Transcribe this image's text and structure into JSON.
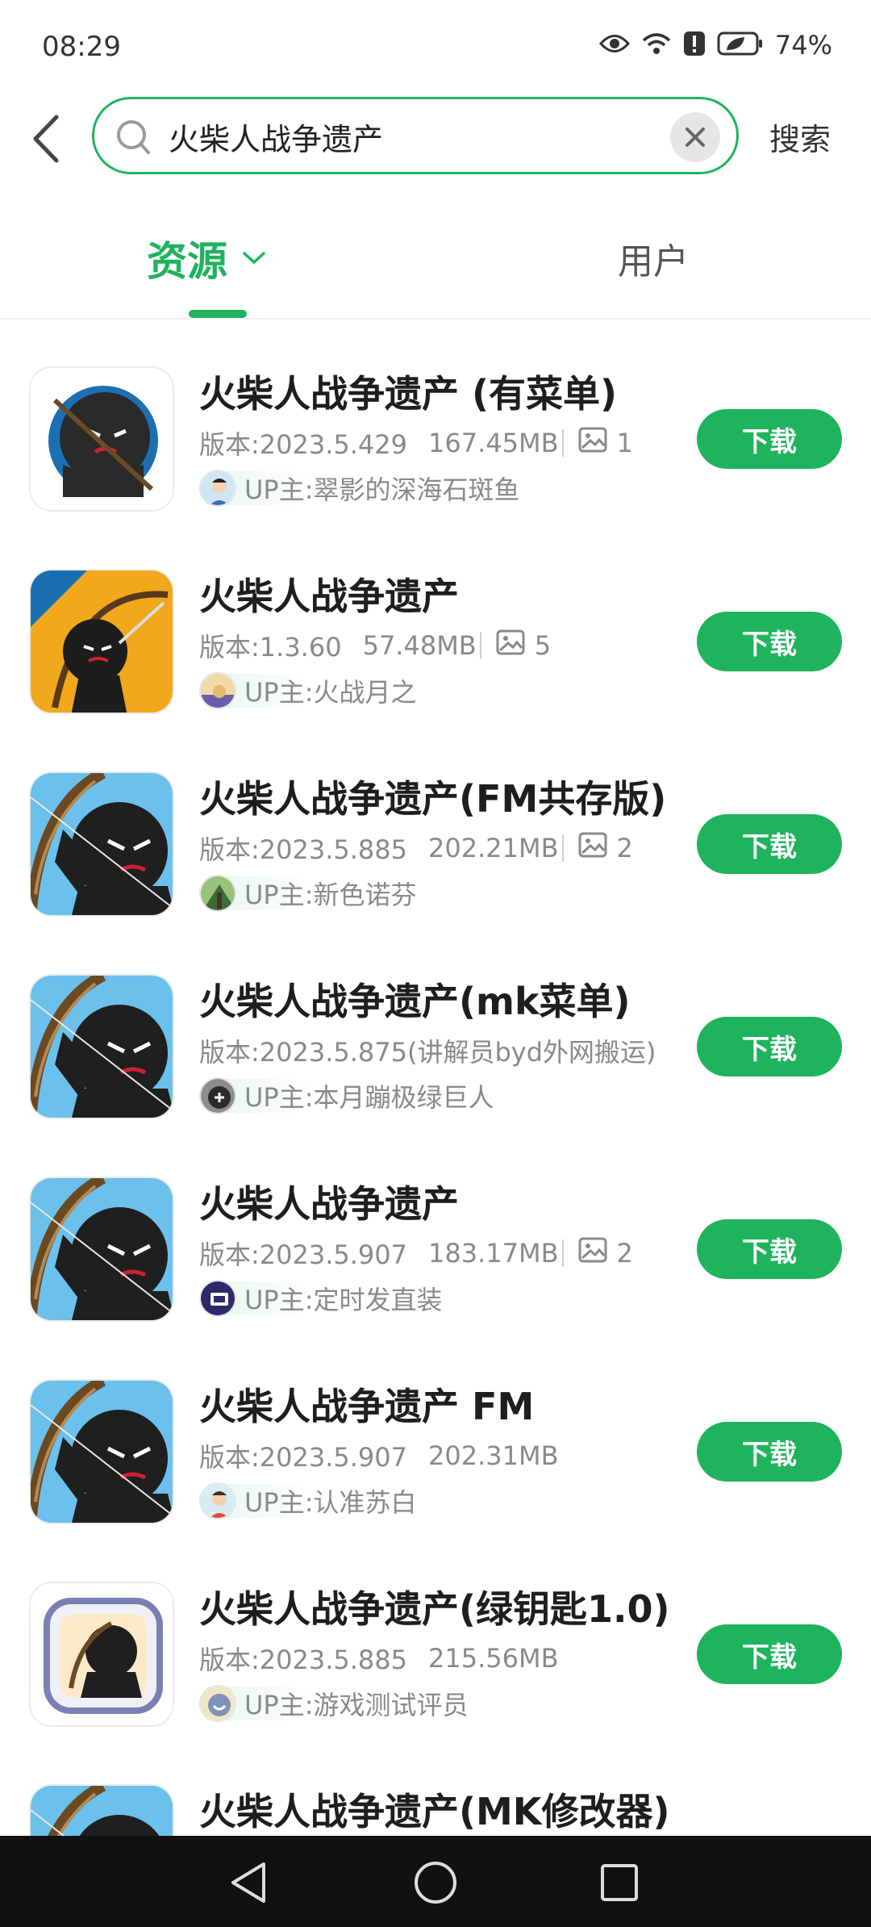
{
  "status_bar": {
    "time": "08:29",
    "battery": "74%",
    "icons": [
      "eye-icon",
      "wifi-icon",
      "alert-icon",
      "battery-icon"
    ]
  },
  "search": {
    "query": "火柴人战争遗产",
    "placeholder": "",
    "button_label": "搜索"
  },
  "tabs": [
    {
      "label": "资源",
      "active": true
    },
    {
      "label": "用户",
      "active": false
    }
  ],
  "colors": {
    "accent": "#1fb35e",
    "text_primary": "#1e1e1e",
    "text_secondary": "#8a8a8a"
  },
  "results": [
    {
      "title": "火柴人战争遗产 (有菜单)",
      "version": "版本:2023.5.429",
      "size": "167.45MB",
      "image_count": "1",
      "uploader": "UP主:翠影的深海石斑鱼",
      "icon": "stickman-round-icon",
      "download_label": "下载"
    },
    {
      "title": "火柴人战争遗产",
      "version": "版本:1.3.60",
      "size": "57.48MB",
      "image_count": "5",
      "uploader": "UP主:火战月之",
      "icon": "stickman-archer-yellow-icon",
      "download_label": "下载"
    },
    {
      "title": "火柴人战争遗产(FM共存版)",
      "version": "版本:2023.5.885",
      "size": "202.21MB",
      "image_count": "2",
      "uploader": "UP主:新色诺芬",
      "icon": "stickman-archer-blue-icon",
      "download_label": "下载"
    },
    {
      "title": "火柴人战争遗产(mk菜单)",
      "version": "版本:2023.5.875(讲解员byd外网搬运)",
      "size": "",
      "image_count": "",
      "uploader": "UP主:本月蹦极绿巨人",
      "icon": "stickman-archer-blue-icon",
      "download_label": "下载"
    },
    {
      "title": "火柴人战争遗产",
      "version": "版本:2023.5.907",
      "size": "183.17MB",
      "image_count": "2",
      "uploader": "UP主:定时发直装",
      "icon": "stickman-archer-blue-icon",
      "download_label": "下载"
    },
    {
      "title": "火柴人战争遗产 FM",
      "version": "版本:2023.5.907",
      "size": "202.31MB",
      "image_count": "",
      "uploader": "UP主:认准苏白",
      "icon": "stickman-archer-blue-icon",
      "download_label": "下载"
    },
    {
      "title": "火柴人战争遗产(绿钥匙1.0)",
      "version": "版本:2023.5.885",
      "size": "215.56MB",
      "image_count": "",
      "uploader": "UP主:游戏测试评员",
      "icon": "stickman-framed-icon",
      "download_label": "下载"
    },
    {
      "title": "火柴人战争遗产(MK修改器)",
      "version": "",
      "size": "",
      "image_count": "",
      "uploader": "",
      "icon": "stickman-archer-blue-icon",
      "download_label": ""
    }
  ],
  "nav": [
    "back-nav-icon",
    "home-nav-icon",
    "recents-nav-icon"
  ]
}
